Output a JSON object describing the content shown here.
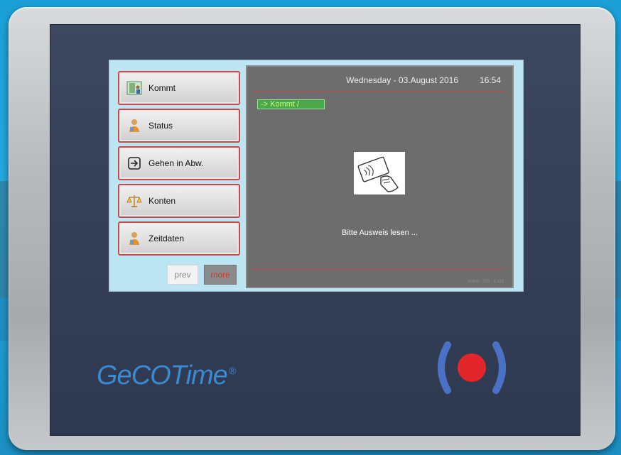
{
  "menu": {
    "items": [
      {
        "label": "Kommt",
        "icon": "enter-door-icon"
      },
      {
        "label": "Status",
        "icon": "person-status-icon"
      },
      {
        "label": "Gehen in Abw.",
        "icon": "exit-arrow-icon"
      },
      {
        "label": "Konten",
        "icon": "balance-scale-icon"
      },
      {
        "label": "Zeitdaten",
        "icon": "person-clock-icon"
      }
    ],
    "prev_label": "prev",
    "more_label": "more"
  },
  "main": {
    "date": "Wednesday - 03.August  2016",
    "time": "16:54",
    "status_badge": "->  Kommt   /",
    "message": "Bitte Ausweis lesen ...",
    "footer": "online - 203 - 8.113"
  },
  "device": {
    "brand": "GeCOTime",
    "brand_mark": "®"
  },
  "colors": {
    "accent_red": "#c74a4a",
    "status_green": "#4aa84a",
    "brand_blue": "#3a8ad1",
    "rfid_red": "#e3262b"
  }
}
